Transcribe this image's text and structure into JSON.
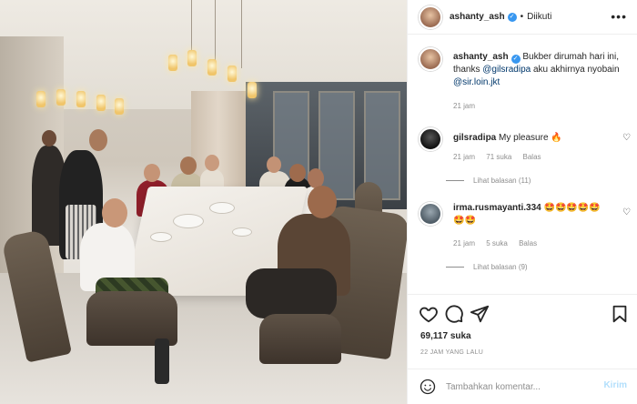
{
  "header": {
    "username": "ashanty_ash",
    "follow_status": "Diikuti",
    "separator": "•"
  },
  "caption": {
    "username": "ashanty_ash",
    "text_part1": "Bukber dirumah hari ini, thanks ",
    "mention1": "@gilsradipa",
    "text_part2": " aku akhirnya nyobain ",
    "mention2": "@sir.loin.jkt",
    "time": "21 jam"
  },
  "comments": [
    {
      "username": "gilsradipa",
      "text": "My pleasure 🔥",
      "time": "21 jam",
      "likes": "71 suka",
      "reply_label": "Balas",
      "view_replies": "Lihat balasan (11)"
    },
    {
      "username": "irma.rusmayanti.334",
      "text": "🤩🤩🤩🤩🤩🤩🤩",
      "time": "21 jam",
      "likes": "5 suka",
      "reply_label": "Balas",
      "view_replies": "Lihat balasan (9)"
    }
  ],
  "actions": {
    "like_count": "69,117 suka",
    "time_ago": "22 JAM YANG LALU"
  },
  "composer": {
    "placeholder": "Tambahkan komentar...",
    "post_label": "Kirim"
  },
  "icons": {
    "verified": "verified-badge-icon",
    "more": "more-options-icon",
    "heart": "heart-icon",
    "comment": "comment-icon",
    "share": "share-icon",
    "save": "bookmark-icon",
    "emoji": "emoji-icon"
  },
  "colors": {
    "verified_blue": "#3897f0",
    "mention": "#00376b",
    "muted": "#8e8e8e",
    "post_button_disabled": "#b2dffc"
  }
}
